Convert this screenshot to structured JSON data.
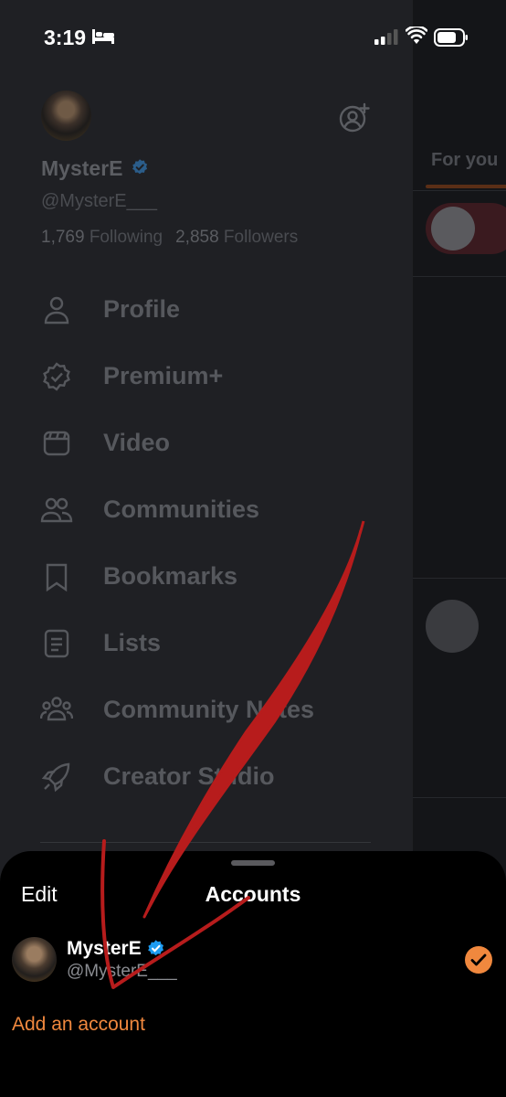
{
  "status_bar": {
    "time": "3:19",
    "icons": [
      "bed-icon",
      "cellular-signal-icon",
      "wifi-icon",
      "battery-icon"
    ]
  },
  "drawer": {
    "display_name": "MysterE",
    "handle": "@MysterE___",
    "following_count": "1,769",
    "following_label": "Following",
    "followers_count": "2,858",
    "followers_label": "Followers",
    "nav": [
      {
        "label": "Profile",
        "icon": "person-icon"
      },
      {
        "label": "Premium+",
        "icon": "verified-badge-icon"
      },
      {
        "label": "Video",
        "icon": "video-icon"
      },
      {
        "label": "Communities",
        "icon": "communities-icon"
      },
      {
        "label": "Bookmarks",
        "icon": "bookmark-icon"
      },
      {
        "label": "Lists",
        "icon": "list-icon"
      },
      {
        "label": "Community Notes",
        "icon": "community-notes-icon"
      },
      {
        "label": "Creator Studio",
        "icon": "rocket-icon"
      }
    ]
  },
  "timeline": {
    "tab_label": "For you"
  },
  "sheet": {
    "edit_label": "Edit",
    "title": "Accounts",
    "account_name": "MysterE",
    "account_handle": "@MysterE___",
    "add_account_label": "Add an account"
  },
  "colors": {
    "accent": "#f0883e",
    "verified": "#1d9bf0",
    "annotation": "#b71c1c",
    "drawer_bg": "#1f2024",
    "sheet_bg": "#000000"
  }
}
